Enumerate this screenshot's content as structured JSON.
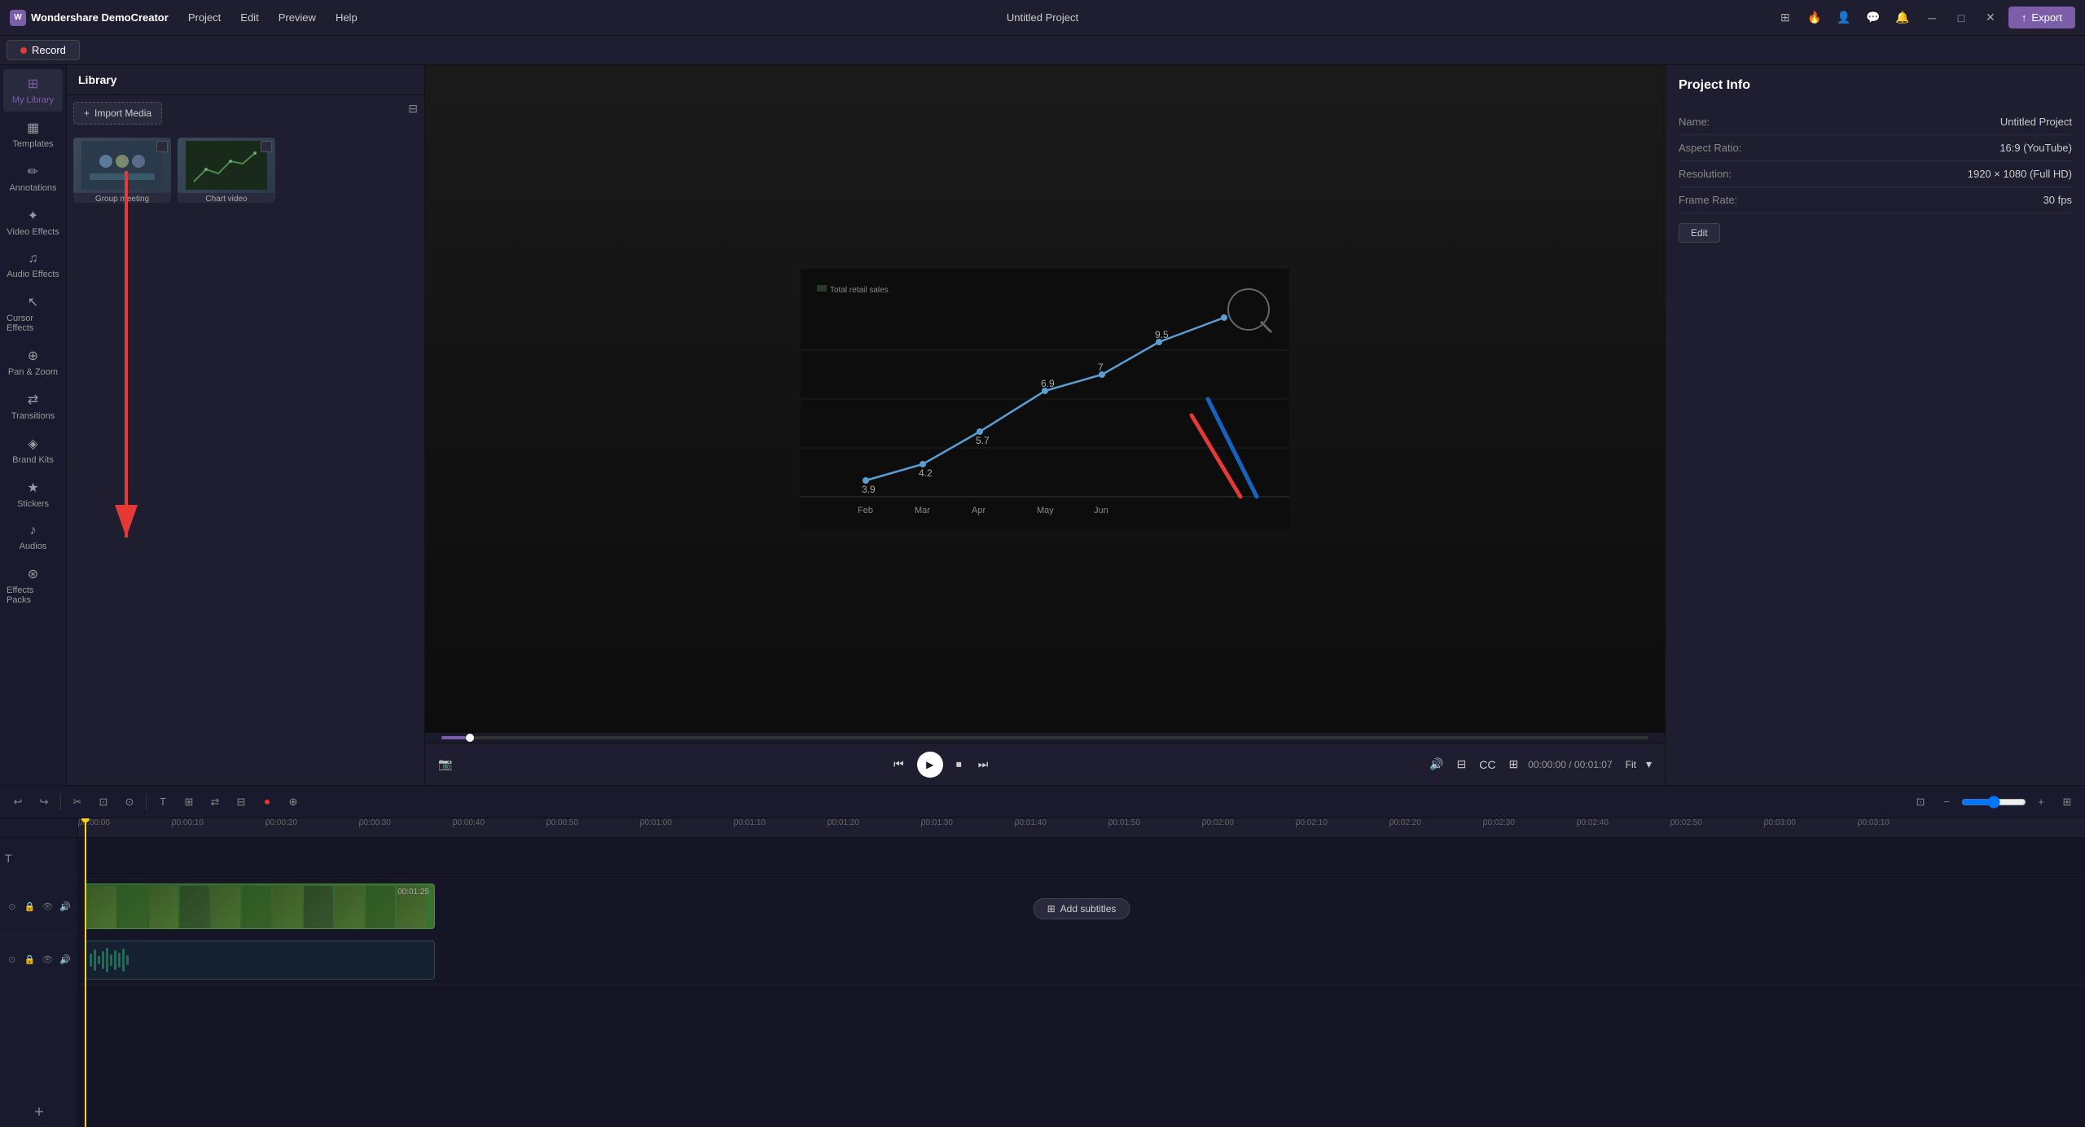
{
  "app": {
    "name": "Wondershare DemoCreator",
    "project_title": "Untitled Project"
  },
  "top_menu": {
    "items": [
      "Project",
      "Edit",
      "Preview",
      "Help"
    ]
  },
  "record_btn": {
    "label": "Record"
  },
  "export_btn": {
    "label": "Export"
  },
  "sidebar": {
    "items": [
      {
        "id": "my-library",
        "label": "My Library",
        "icon": "⊞",
        "active": true
      },
      {
        "id": "templates",
        "label": "Templates",
        "icon": "▦"
      },
      {
        "id": "annotations",
        "label": "Annotations",
        "icon": "✏"
      },
      {
        "id": "video-effects",
        "label": "Video Effects",
        "icon": "✦"
      },
      {
        "id": "audio-effects",
        "label": "Audio Effects",
        "icon": "♫"
      },
      {
        "id": "cursor-effects",
        "label": "Cursor Effects",
        "icon": "↖"
      },
      {
        "id": "pan-zoom",
        "label": "Pan & Zoom",
        "icon": "⊕"
      },
      {
        "id": "transitions",
        "label": "Transitions",
        "icon": "⇄"
      },
      {
        "id": "brand-kits",
        "label": "Brand Kits",
        "icon": "◈"
      },
      {
        "id": "stickers",
        "label": "Stickers",
        "icon": "★"
      },
      {
        "id": "audios",
        "label": "Audios",
        "icon": "♪"
      },
      {
        "id": "effects-packs",
        "label": "Effects Packs",
        "icon": "⊛"
      }
    ]
  },
  "library": {
    "title": "Library",
    "import_btn": "Import Media",
    "media_items": [
      {
        "label": "Group meeting",
        "type": "video"
      },
      {
        "label": "Chart video",
        "type": "video"
      }
    ]
  },
  "project_info": {
    "title": "Project Info",
    "fields": [
      {
        "label": "Name:",
        "value": "Untitled Project"
      },
      {
        "label": "Aspect Ratio:",
        "value": "16:9 (YouTube)"
      },
      {
        "label": "Resolution:",
        "value": "1920 × 1080 (Full HD)"
      },
      {
        "label": "Frame Rate:",
        "value": "30 fps"
      }
    ],
    "edit_btn": "Edit"
  },
  "playback": {
    "current_time": "00:00:00",
    "total_time": "00:01:07",
    "fit_label": "Fit"
  },
  "timeline": {
    "zoom_level": "50%",
    "ruler_marks": [
      "00:00:00",
      "00:00:10",
      "00:00:20",
      "00:00:30",
      "00:00:40",
      "00:00:50",
      "00:01:00",
      "00:01:10",
      "00:01:20",
      "00:01:30",
      "00:01:40",
      "00:01:50",
      "00:02:00",
      "00:02:10",
      "00:02:20",
      "00:02:30",
      "00:02:40",
      "00:02:50",
      "00:03:00",
      "00:03:10"
    ],
    "video_clip": {
      "duration": "00:01:25"
    },
    "add_subtitles": "Add subtitles"
  },
  "toolbar": {
    "undo_label": "Undo",
    "redo_label": "Redo"
  }
}
